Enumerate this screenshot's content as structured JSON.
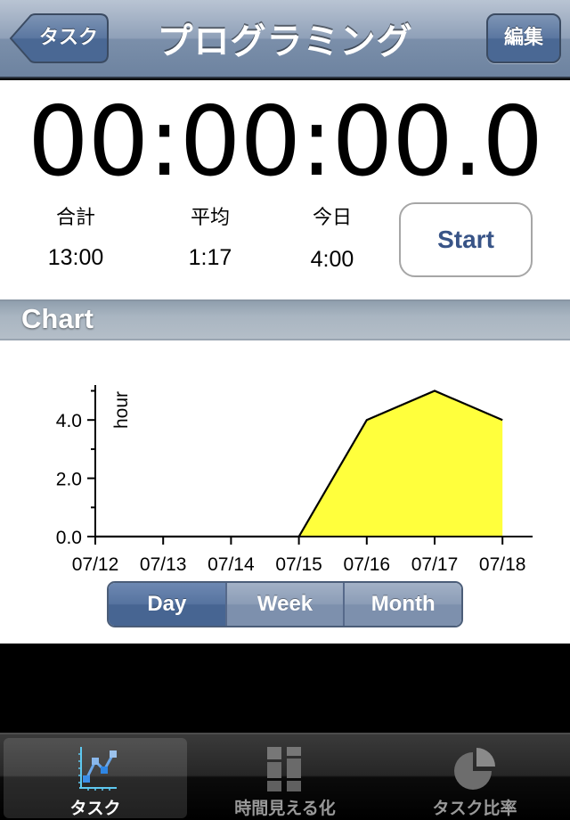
{
  "navbar": {
    "back_label": "タスク",
    "title": "プログラミング",
    "edit_label": "編集"
  },
  "timer": {
    "display": "00:00:00.0"
  },
  "stats": {
    "total": {
      "label": "合計",
      "value": "13:00"
    },
    "average": {
      "label": "平均",
      "value": "1:17"
    },
    "today": {
      "label": "今日",
      "value": "4:00"
    }
  },
  "start_button": {
    "label": "Start"
  },
  "section": {
    "title": "Chart"
  },
  "segmented": {
    "options": [
      "Day",
      "Week",
      "Month"
    ],
    "selected": "Day"
  },
  "tabbar": {
    "items": [
      {
        "label": "タスク",
        "icon": "line-chart-icon",
        "selected": true
      },
      {
        "label": "時間見える化",
        "icon": "stacked-bars-icon",
        "selected": false
      },
      {
        "label": "タスク比率",
        "icon": "pie-chart-icon",
        "selected": false
      }
    ]
  },
  "colors": {
    "area_fill": "#ffff3c",
    "accent_blue": "#385487",
    "segment_selected": "#476592"
  },
  "chart_data": {
    "type": "area",
    "title": "",
    "xlabel": "",
    "ylabel": "hour",
    "categories": [
      "07/12",
      "07/13",
      "07/14",
      "07/15",
      "07/16",
      "07/17",
      "07/18"
    ],
    "values": [
      0,
      0,
      0,
      0,
      4.0,
      5.0,
      4.0
    ],
    "ylim": [
      0,
      5.2
    ],
    "yticks": [
      0,
      2,
      4
    ],
    "ytick_labels": [
      "0.0",
      "2.0",
      "4.0"
    ],
    "minor_yticks": [
      1,
      3,
      5
    ],
    "grid": false,
    "legend": "none"
  }
}
